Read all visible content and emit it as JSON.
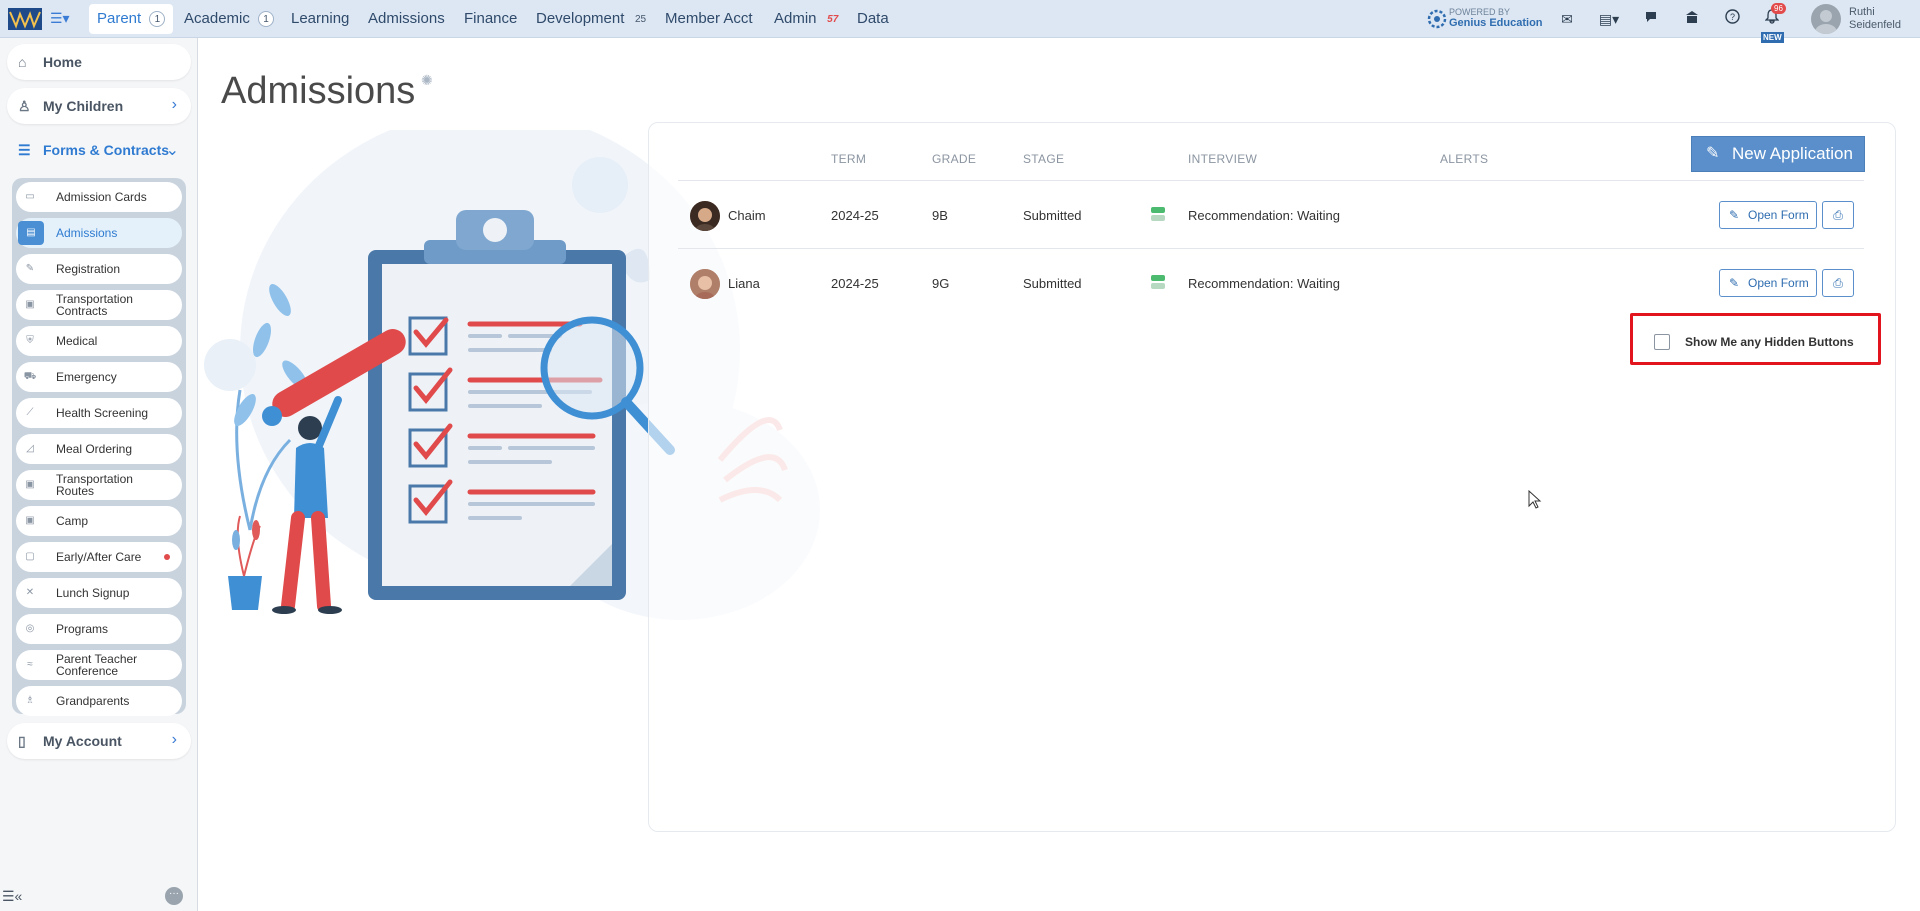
{
  "topbar": {
    "tabs": [
      {
        "label": "Parent",
        "badge": "1"
      },
      {
        "label": "Academic",
        "badge": "1"
      },
      {
        "label": "Learning",
        "badge": ""
      },
      {
        "label": "Admissions",
        "badge": ""
      },
      {
        "label": "Finance",
        "badge": ""
      },
      {
        "label": "Development",
        "badge": "25"
      },
      {
        "label": "Member Acct",
        "badge": ""
      },
      {
        "label": "Admin",
        "badge": "57"
      },
      {
        "label": "Data",
        "badge": ""
      }
    ],
    "powered_by": "POWERED BY",
    "powered_brand": "Genius Education",
    "notifications_count": "96",
    "new_tag": "NEW",
    "user_first": "Ruthi",
    "user_last": "Seidenfeld",
    "icons": [
      "mail-icon",
      "clipboard-icon",
      "chat-icon",
      "school-icon",
      "help-icon",
      "bell-icon"
    ]
  },
  "sidebar": {
    "home": "Home",
    "my_children": "My Children",
    "forms_contracts": "Forms & Contracts",
    "items": [
      {
        "label": "Admission Cards"
      },
      {
        "label": "Admissions"
      },
      {
        "label": "Registration"
      },
      {
        "label": "Transportation Contracts"
      },
      {
        "label": "Medical"
      },
      {
        "label": "Emergency"
      },
      {
        "label": "Health Screening"
      },
      {
        "label": "Meal Ordering"
      },
      {
        "label": "Transportation Routes"
      },
      {
        "label": "Camp"
      },
      {
        "label": "Early/After Care"
      },
      {
        "label": "Lunch Signup"
      },
      {
        "label": "Programs"
      },
      {
        "label": "Parent Teacher Conference"
      },
      {
        "label": "Grandparents"
      }
    ],
    "my_account": "My Account"
  },
  "main": {
    "title": "Admissions",
    "new_application_label": "New Application",
    "columns": {
      "term": "TERM",
      "grade": "GRADE",
      "stage": "STAGE",
      "interview": "INTERVIEW",
      "alerts": "ALERTS"
    },
    "rows": [
      {
        "name": "Chaim",
        "term": "2024-25",
        "grade": "9B",
        "stage": "Submitted",
        "interview": "Recommendation: Waiting",
        "open_label": "Open Form"
      },
      {
        "name": "Liana",
        "term": "2024-25",
        "grade": "9G",
        "stage": "Submitted",
        "interview": "Recommendation: Waiting",
        "open_label": "Open Form"
      }
    ],
    "hidden_buttons_label": "Show Me any Hidden Buttons",
    "hidden_buttons_checked": false
  },
  "colors": {
    "accent": "#2f7bd1",
    "topbar_bg": "#dde7f3",
    "primary_button": "#5a8fcb",
    "highlight_border": "#e2141e",
    "stage_green": "#4cbb6f"
  }
}
